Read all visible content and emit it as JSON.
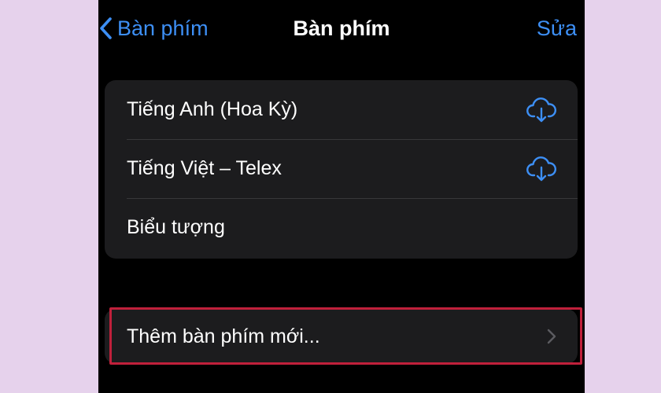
{
  "nav": {
    "back_label": "Bàn phím",
    "title": "Bàn phím",
    "edit_label": "Sửa"
  },
  "keyboards": [
    {
      "label": "Tiếng Anh (Hoa Kỳ)",
      "icon": "cloud-download-icon"
    },
    {
      "label": "Tiếng Việt – Telex",
      "icon": "cloud-download-icon"
    },
    {
      "label": "Biểu tượng",
      "icon": null
    }
  ],
  "add_keyboard": {
    "label": "Thêm bàn phím mới...",
    "icon": "chevron-right-icon"
  },
  "colors": {
    "accent": "#3d8ff5",
    "cell_background": "#1c1c1e",
    "highlight_border": "#c0203b",
    "page_background": "#e6d2ec"
  }
}
